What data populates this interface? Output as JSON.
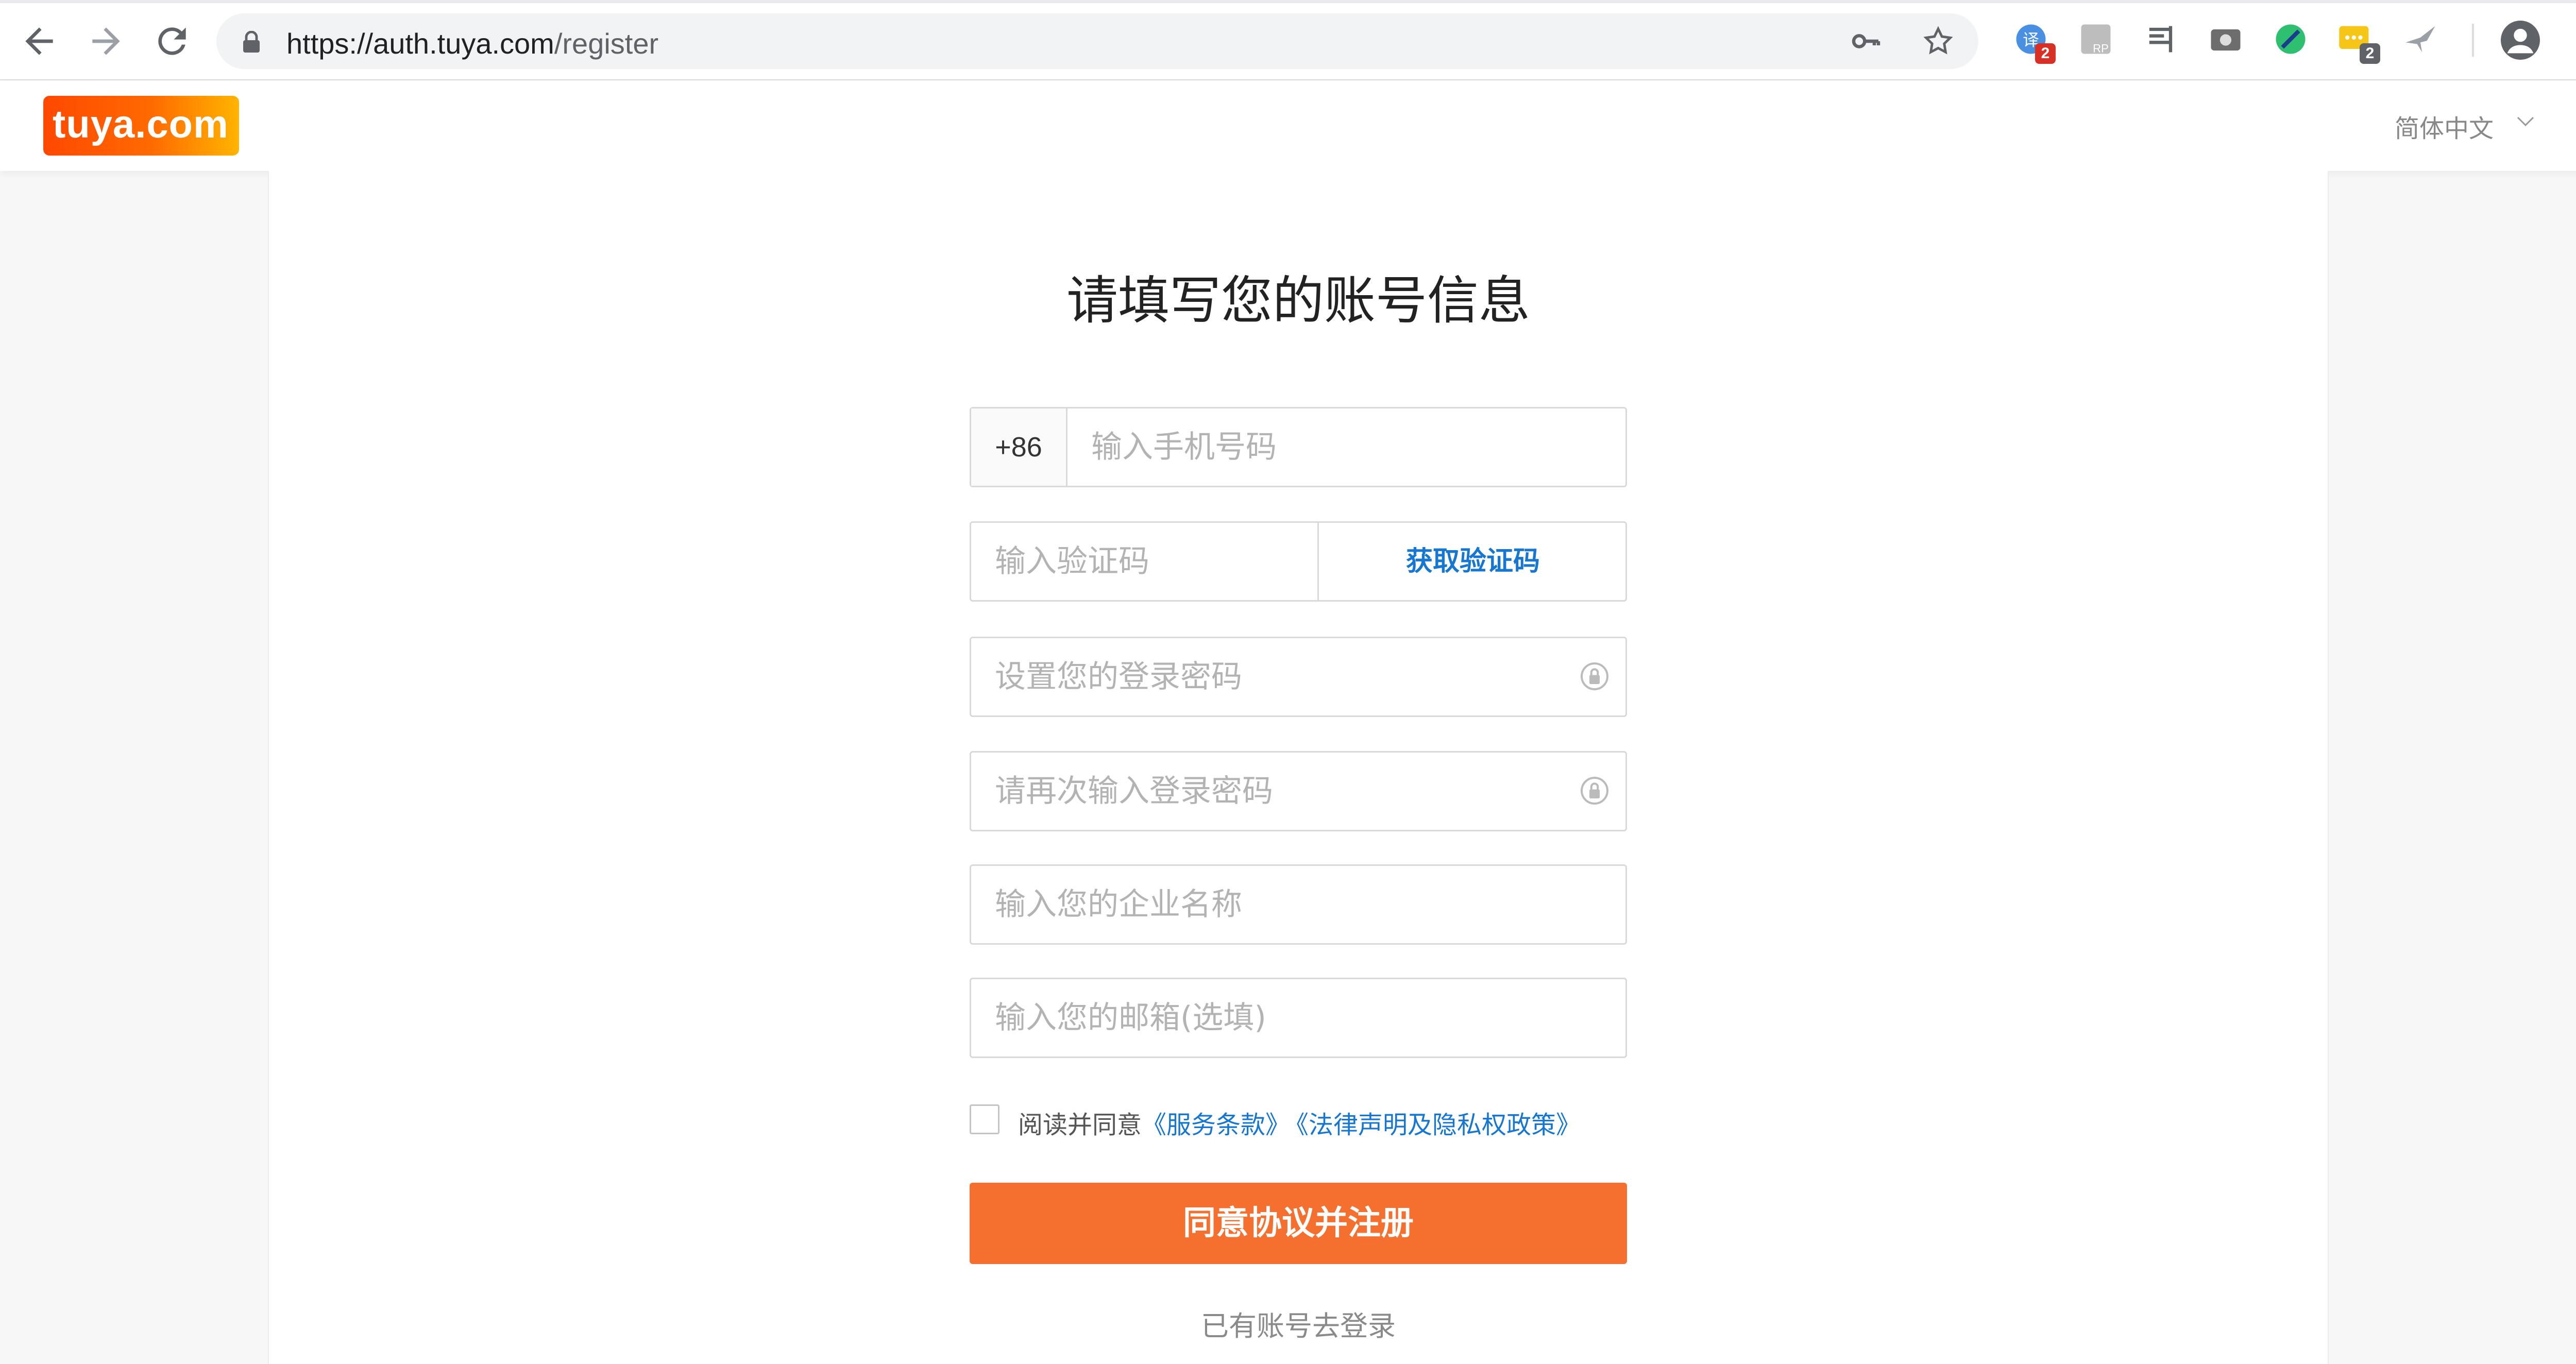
{
  "browser": {
    "url_host": "https://auth.tuya.com",
    "url_path": "/register",
    "extensions": [
      {
        "name": "translate-extension-icon",
        "badge": "2",
        "color": "#4a90e2",
        "badge_color": "#d93025"
      },
      {
        "name": "axure-rp-extension-icon",
        "badge": "",
        "color": "#9e9e9e"
      },
      {
        "name": "reader-extension-icon",
        "badge": "",
        "color": "#5f6368"
      },
      {
        "name": "screenshot-extension-icon",
        "badge": "",
        "color": "#5f6368"
      },
      {
        "name": "color-picker-extension-icon",
        "badge": "",
        "color": "#2fbf71"
      },
      {
        "name": "chat-extension-icon",
        "badge": "2",
        "color": "#f5c518",
        "badge_color": "#5f6368"
      },
      {
        "name": "bird-extension-icon",
        "badge": "",
        "color": "#9aa0a6"
      }
    ]
  },
  "header": {
    "logo_text": "tuya.com",
    "language": "简体中文"
  },
  "form": {
    "title": "请填写您的账号信息",
    "phone_prefix": "+86",
    "phone_placeholder": "输入手机号码",
    "code_placeholder": "输入验证码",
    "get_code_label": "获取验证码",
    "password_placeholder": "设置您的登录密码",
    "password_confirm_placeholder": "请再次输入登录密码",
    "company_placeholder": "输入您的企业名称",
    "email_placeholder": "输入您的邮箱(选填)",
    "agree_text": "阅读并同意",
    "terms_link": "《服务条款》",
    "privacy_link": "《法律声明及隐私权政策》",
    "submit_label": "同意协议并注册",
    "login_link": "已有账号去登录"
  },
  "colors": {
    "accent": "#f5702e",
    "link": "#1677d2"
  }
}
